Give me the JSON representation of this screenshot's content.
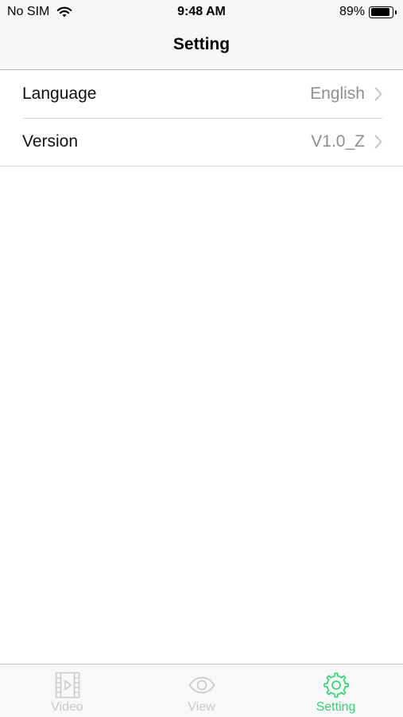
{
  "status_bar": {
    "carrier": "No SIM",
    "time": "9:48 AM",
    "battery_percent": "89%",
    "battery_level": 0.89
  },
  "nav": {
    "title": "Setting"
  },
  "settings": {
    "items": [
      {
        "label": "Language",
        "value": "English"
      },
      {
        "label": "Version",
        "value": "V1.0_Z"
      }
    ]
  },
  "tab_bar": {
    "tabs": [
      {
        "label": "Video",
        "icon": "film-play-icon",
        "active": false
      },
      {
        "label": "View",
        "icon": "eye-icon",
        "active": false
      },
      {
        "label": "Setting",
        "icon": "gear-icon",
        "active": true
      }
    ],
    "active_color": "#3ccf7a",
    "inactive_color": "#c9c9c9"
  }
}
